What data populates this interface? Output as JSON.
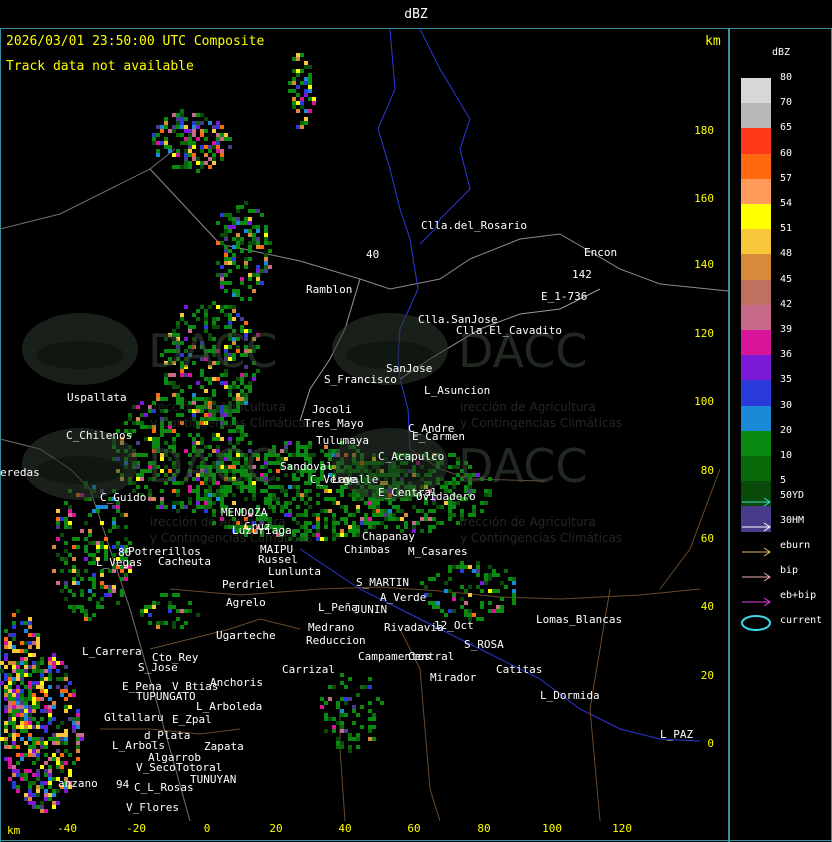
{
  "window": {
    "title": "dBZ"
  },
  "header": {
    "timestamp": "2026/03/01 23:50:00 UTC Composite",
    "track_status": "Track data not available",
    "unit_label": "km"
  },
  "axes": {
    "x_unit": "km",
    "x_ticks": [
      "-40",
      "-20",
      "0",
      "20",
      "40",
      "60",
      "80",
      "100",
      "120"
    ],
    "y_ticks": [
      "180",
      "160",
      "140",
      "120",
      "100",
      "80",
      "60",
      "40",
      "20",
      "0"
    ]
  },
  "watermark": {
    "brand": "DACC",
    "subtitle_line1": "irección de Agricultura",
    "subtitle_line2": "y Contingencias Climáticas",
    "brand_color": "#3d4a3d"
  },
  "places": [
    {
      "name": "Clla.del_Rosario"
    },
    {
      "name": "Encon"
    },
    {
      "name": "142"
    },
    {
      "name": "E_1-736"
    },
    {
      "name": "Ramblon"
    },
    {
      "name": "Clla.SanJose"
    },
    {
      "name": "Clla.El_Cavadito"
    },
    {
      "name": "S_Francisco"
    },
    {
      "name": "SanJose"
    },
    {
      "name": "L_Asuncion"
    },
    {
      "name": "Uspallata"
    },
    {
      "name": "Jocoli"
    },
    {
      "name": "Tres_Mayo"
    },
    {
      "name": "C_Andre"
    },
    {
      "name": "Tulumaya"
    },
    {
      "name": "E_Carmen"
    },
    {
      "name": "C_Chilenos"
    },
    {
      "name": "eredas"
    },
    {
      "name": "C_Acapulco"
    },
    {
      "name": "Lavalle"
    },
    {
      "name": "Sandoval"
    },
    {
      "name": "C_Verge"
    },
    {
      "name": "Ovidadero"
    },
    {
      "name": "C_Guido"
    },
    {
      "name": "E_Central"
    },
    {
      "name": "MENDOZA"
    },
    {
      "name": "Luzuriaga"
    },
    {
      "name": "Cruz"
    },
    {
      "name": "Chapanay"
    },
    {
      "name": "Potrerillos"
    },
    {
      "name": "Cacheuta"
    },
    {
      "name": "L_Vegas"
    },
    {
      "name": "MAIPU"
    },
    {
      "name": "Russel"
    },
    {
      "name": "Lunlunta"
    },
    {
      "name": "Chimbas"
    },
    {
      "name": "M_Casares"
    },
    {
      "name": "Perdriel"
    },
    {
      "name": "S_MARTIN"
    },
    {
      "name": "A_Verde"
    },
    {
      "name": "Agrelo"
    },
    {
      "name": "Ugarteche"
    },
    {
      "name": "L_Peña"
    },
    {
      "name": "JUNIN"
    },
    {
      "name": "Rivadavia"
    },
    {
      "name": "Medrano"
    },
    {
      "name": "Reduccion"
    },
    {
      "name": "12_Oct"
    },
    {
      "name": "S_ROSA"
    },
    {
      "name": "Lomas_Blancas"
    },
    {
      "name": "L_Carrera"
    },
    {
      "name": "Cto_Rey"
    },
    {
      "name": "S_Jose"
    },
    {
      "name": "Campamentos"
    },
    {
      "name": "Central"
    },
    {
      "name": "Catitas"
    },
    {
      "name": "Carrizal"
    },
    {
      "name": "Mirador"
    },
    {
      "name": "V_Btias"
    },
    {
      "name": "Anchoris"
    },
    {
      "name": "E_Pena"
    },
    {
      "name": "TUPUNGATO"
    },
    {
      "name": "L_Arboleda"
    },
    {
      "name": "L_Dormida"
    },
    {
      "name": "Gltallaru"
    },
    {
      "name": "E_Zpal"
    },
    {
      "name": "L_Arbols"
    },
    {
      "name": "d_Plata"
    },
    {
      "name": "Zapata"
    },
    {
      "name": "L_PAZ"
    },
    {
      "name": "Algarrob"
    },
    {
      "name": "V_Seco"
    },
    {
      "name": "Totoral"
    },
    {
      "name": "TUNUYAN"
    },
    {
      "name": "anzano"
    },
    {
      "name": "C_L_Rosas"
    },
    {
      "name": "V_Flores"
    },
    {
      "name": "40"
    },
    {
      "name": "80"
    },
    {
      "name": "94"
    }
  ],
  "legend": {
    "title": "dBZ",
    "scale": [
      {
        "label": "80",
        "color": "#d8d8d8"
      },
      {
        "label": "70",
        "color": "#b8b8b8"
      },
      {
        "label": "65",
        "color": "#ff3a1a"
      },
      {
        "label": "60",
        "color": "#ff6a10"
      },
      {
        "label": "57",
        "color": "#ff9a5a"
      },
      {
        "label": "54",
        "color": "#ffff00"
      },
      {
        "label": "51",
        "color": "#f8c83a"
      },
      {
        "label": "48",
        "color": "#d88a3a"
      },
      {
        "label": "45",
        "color": "#c07060"
      },
      {
        "label": "42",
        "color": "#c86a8a"
      },
      {
        "label": "39",
        "color": "#d8149a"
      },
      {
        "label": "36",
        "color": "#7a1ad8"
      },
      {
        "label": "35",
        "color": "#2a3ad8"
      },
      {
        "label": "30",
        "color": "#1a8ad8"
      },
      {
        "label": "20",
        "color": "#0a8a10"
      },
      {
        "label": "10",
        "color": "#0a6a0a"
      },
      {
        "label": "5",
        "color": "#0a4a0a"
      },
      {
        "label": "",
        "color": "#4a3a8a"
      }
    ],
    "tracks": [
      {
        "label": "50YD",
        "color": "#40d8d8",
        "style": "arrow"
      },
      {
        "label": "30HM",
        "color": "#ffffff",
        "style": "arrow"
      },
      {
        "label": "eburn",
        "color": "#e8b860",
        "style": "arrow"
      },
      {
        "label": "bip",
        "color": "#f0b0b0",
        "style": "arrow"
      },
      {
        "label": "eb+bip",
        "color": "#e040e0",
        "style": "arrow"
      },
      {
        "label": "current",
        "color": "#40d8e8",
        "style": "ellipse"
      }
    ]
  }
}
